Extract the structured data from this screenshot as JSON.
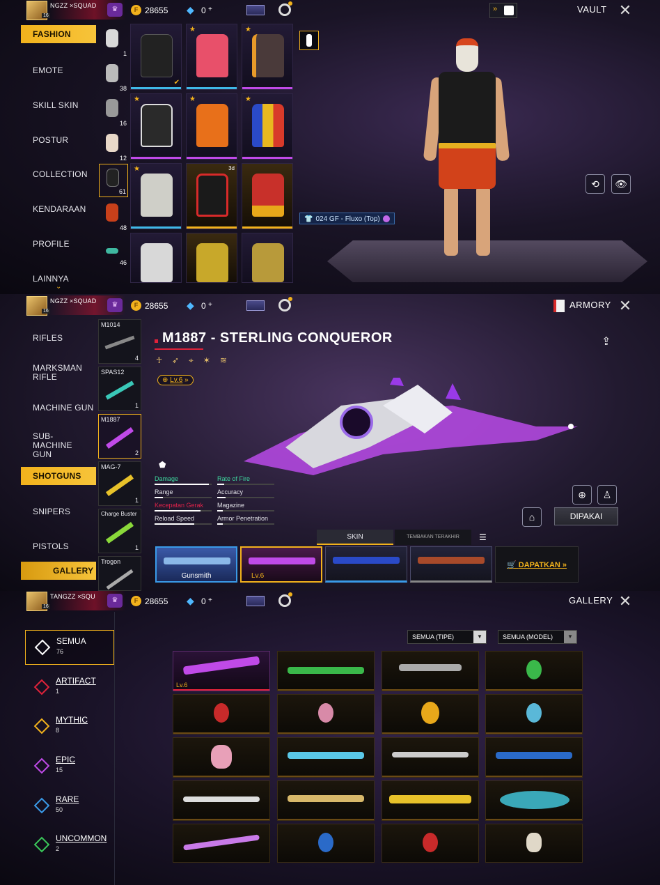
{
  "topbar": {
    "player_name_1": "NGZZ ×SQUAD",
    "player_name_2": "NGZZ ×SQUAD",
    "player_name_3": "TANGZZ ×SQU",
    "avatar_level": "16",
    "gold": "28655",
    "diamonds": "0",
    "diamond_plus": "+"
  },
  "vault": {
    "title": "VAULT",
    "menu": [
      "FASHION",
      "EMOTE",
      "SKILL SKIN",
      "POSTUR",
      "COLLECTION",
      "KENDARAAN",
      "PROFILE",
      "LAINNYA"
    ],
    "thumb_counts": [
      "1",
      "38",
      "16",
      "12",
      "61",
      "48",
      "46"
    ],
    "equipped_label": "024 GF - Fluxo (Top)",
    "timer_tag": "3d"
  },
  "armory": {
    "title": "ARMORY",
    "menu": [
      "RIFLES",
      "MARKSMAN RIFLE",
      "MACHINE GUN",
      "SUB-MACHINE GUN",
      "SHOTGUNS",
      "SNIPERS",
      "PISTOLS",
      "GALLERY"
    ],
    "weapons": [
      {
        "name": "M1014",
        "count": "4"
      },
      {
        "name": "SPAS12",
        "count": "1"
      },
      {
        "name": "M1887",
        "count": "2"
      },
      {
        "name": "MAG-7",
        "count": "1"
      },
      {
        "name": "Charge Buster",
        "count": "1"
      },
      {
        "name": "Trogon",
        "count": ""
      }
    ],
    "weapon_title": "M1887 - STERLING CONQUEROR",
    "level": "Lv.6",
    "stats": [
      {
        "label": "Damage",
        "value": 0.95,
        "color": "#3fd8a0"
      },
      {
        "label": "Rate of Fire",
        "value": 0.12,
        "color": "#3fd8a0"
      },
      {
        "label": "Range",
        "value": 0.15,
        "color": "#e0e0e6"
      },
      {
        "label": "Accuracy",
        "value": 0.15,
        "color": "#e0e0e6"
      },
      {
        "label": "Kecepatan Gerak",
        "value": 0.8,
        "color": "#e0224a"
      },
      {
        "label": "Magazine",
        "value": 0.1,
        "color": "#e0e0e6"
      },
      {
        "label": "Reload Speed",
        "value": 0.7,
        "color": "#e0e0e6"
      },
      {
        "label": "Armor Penetration",
        "value": 0.1,
        "color": "#e0e0e6"
      }
    ],
    "tabs": [
      "SKIN",
      "TEMBAKAN TERAKHIR"
    ],
    "skins": [
      "Gunsmith",
      "Lv.6",
      "",
      ""
    ],
    "equip_button": "DIPAKAI",
    "get_button": "DAPATKAN »"
  },
  "gallery": {
    "title": "GALLERY",
    "filter_type": "SEMUA (TIPE)",
    "filter_model": "SEMUA (MODEL)",
    "rarities": [
      {
        "name": "SEMUA",
        "count": "76",
        "color": "#ffffff"
      },
      {
        "name": "ARTIFACT",
        "count": "1",
        "color": "#e0223a"
      },
      {
        "name": "MYTHIC",
        "count": "8",
        "color": "#f2b21c"
      },
      {
        "name": "EPIC",
        "count": "15",
        "color": "#c04ae8"
      },
      {
        "name": "RARE",
        "count": "50",
        "color": "#3a9ae8"
      },
      {
        "name": "UNCOMMON",
        "count": "2",
        "color": "#3ac85a"
      }
    ],
    "first_item_level": "Lv.6"
  }
}
